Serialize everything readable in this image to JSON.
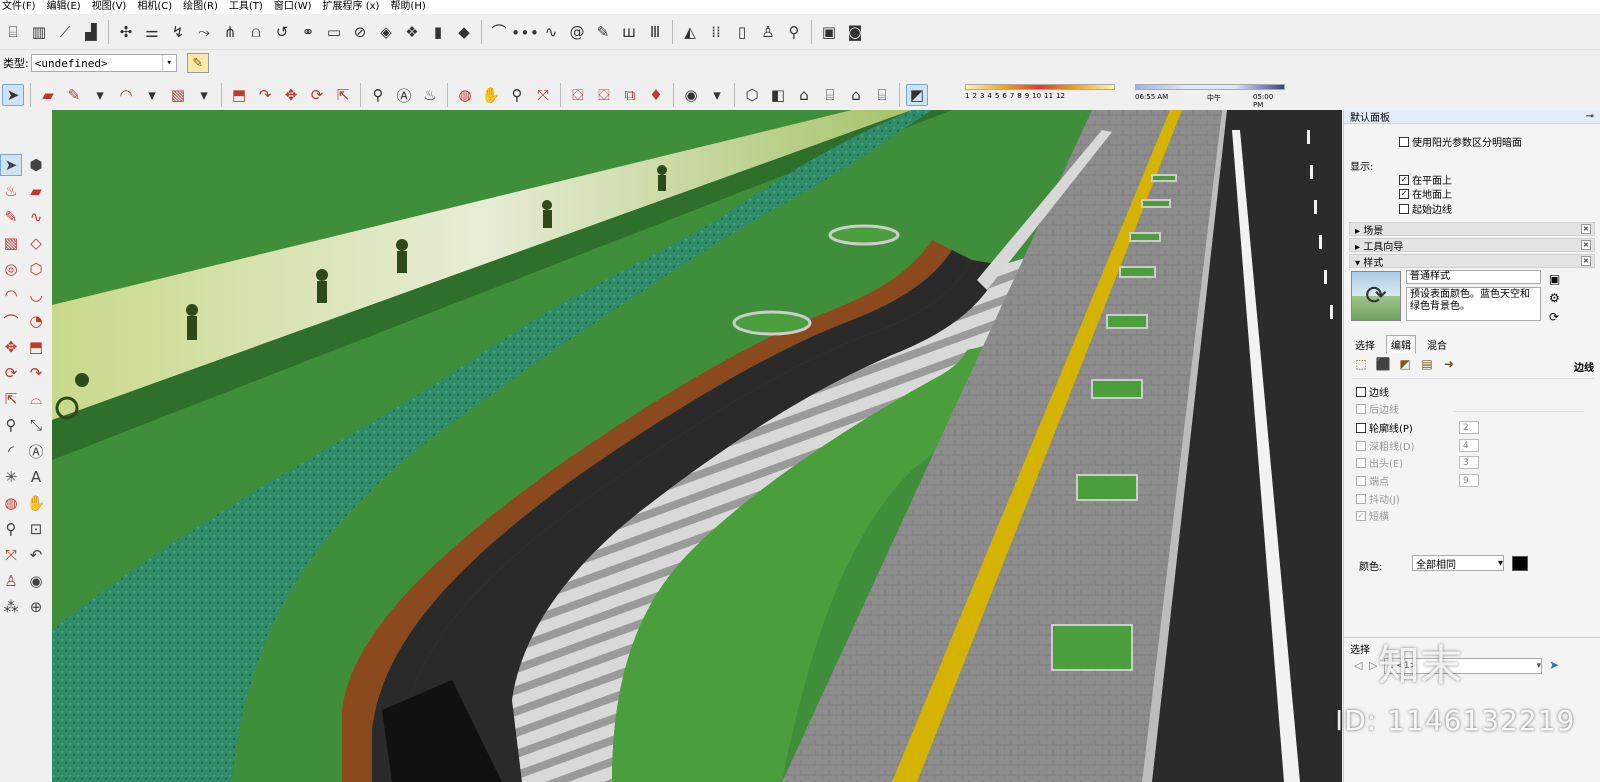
{
  "menu": [
    "文件(F)",
    "编辑(E)",
    "视图(V)",
    "相机(C)",
    "绘图(R)",
    "工具(T)",
    "窗口(W)",
    "扩展程序 (x)",
    "帮助(H)"
  ],
  "layer": {
    "label": "类型:",
    "value": "<undefined>"
  },
  "shadow": {
    "months": [
      "1",
      "2",
      "3",
      "4",
      "5",
      "6",
      "7",
      "8",
      "9",
      "10",
      "11",
      "12"
    ],
    "time_start": "06:55 AM",
    "time_mid": "中午",
    "time_end": "05:00 PM"
  },
  "tray": {
    "title": "默认面板",
    "use_sun": "使用阳光参数区分明暗面",
    "display_label": "显示:",
    "display_opts": [
      {
        "label": "在平面上",
        "checked": true
      },
      {
        "label": "在地面上",
        "checked": true
      },
      {
        "label": "起始边线",
        "checked": false
      }
    ],
    "sections": [
      "场景",
      "工具向导",
      "样式"
    ],
    "style": {
      "name": "普通样式",
      "desc": "预设表面颜色。蓝色天空和绿色背景色。",
      "tabs": [
        "选择",
        "编辑",
        "混合"
      ],
      "edge_title": "边线",
      "edge_opts": [
        {
          "label": "边线",
          "checked": false,
          "enabled": true,
          "value": ""
        },
        {
          "label": "后边线",
          "checked": false,
          "enabled": false,
          "value": ""
        },
        {
          "label": "轮廓线(P)",
          "checked": false,
          "enabled": true,
          "value": "2"
        },
        {
          "label": "深粗线(D)",
          "checked": false,
          "enabled": false,
          "value": "4"
        },
        {
          "label": "出头(E)",
          "checked": false,
          "enabled": false,
          "value": "3"
        },
        {
          "label": "端点",
          "checked": false,
          "enabled": false,
          "value": "9"
        },
        {
          "label": "抖动(J)",
          "checked": false,
          "enabled": false,
          "value": ""
        },
        {
          "label": "短横",
          "checked": true,
          "enabled": false,
          "value": ""
        }
      ],
      "color_label": "颜色:",
      "color_value": "全部相同",
      "color_swatch": "#000000"
    },
    "select_section": "选择",
    "select_value": "i: <1>"
  },
  "watermark": {
    "id": "ID: 1146132219",
    "brand": "知末"
  },
  "scene": {
    "colors": {
      "lawn": "#3f8f3a",
      "hedge": "#2e8a66",
      "road": "#2a2a2a",
      "paving": "#8a8a8a",
      "yellow_line": "#d4b400",
      "bench_wood": "#8b4a1e",
      "bench_white": "#f2f2f2"
    }
  }
}
